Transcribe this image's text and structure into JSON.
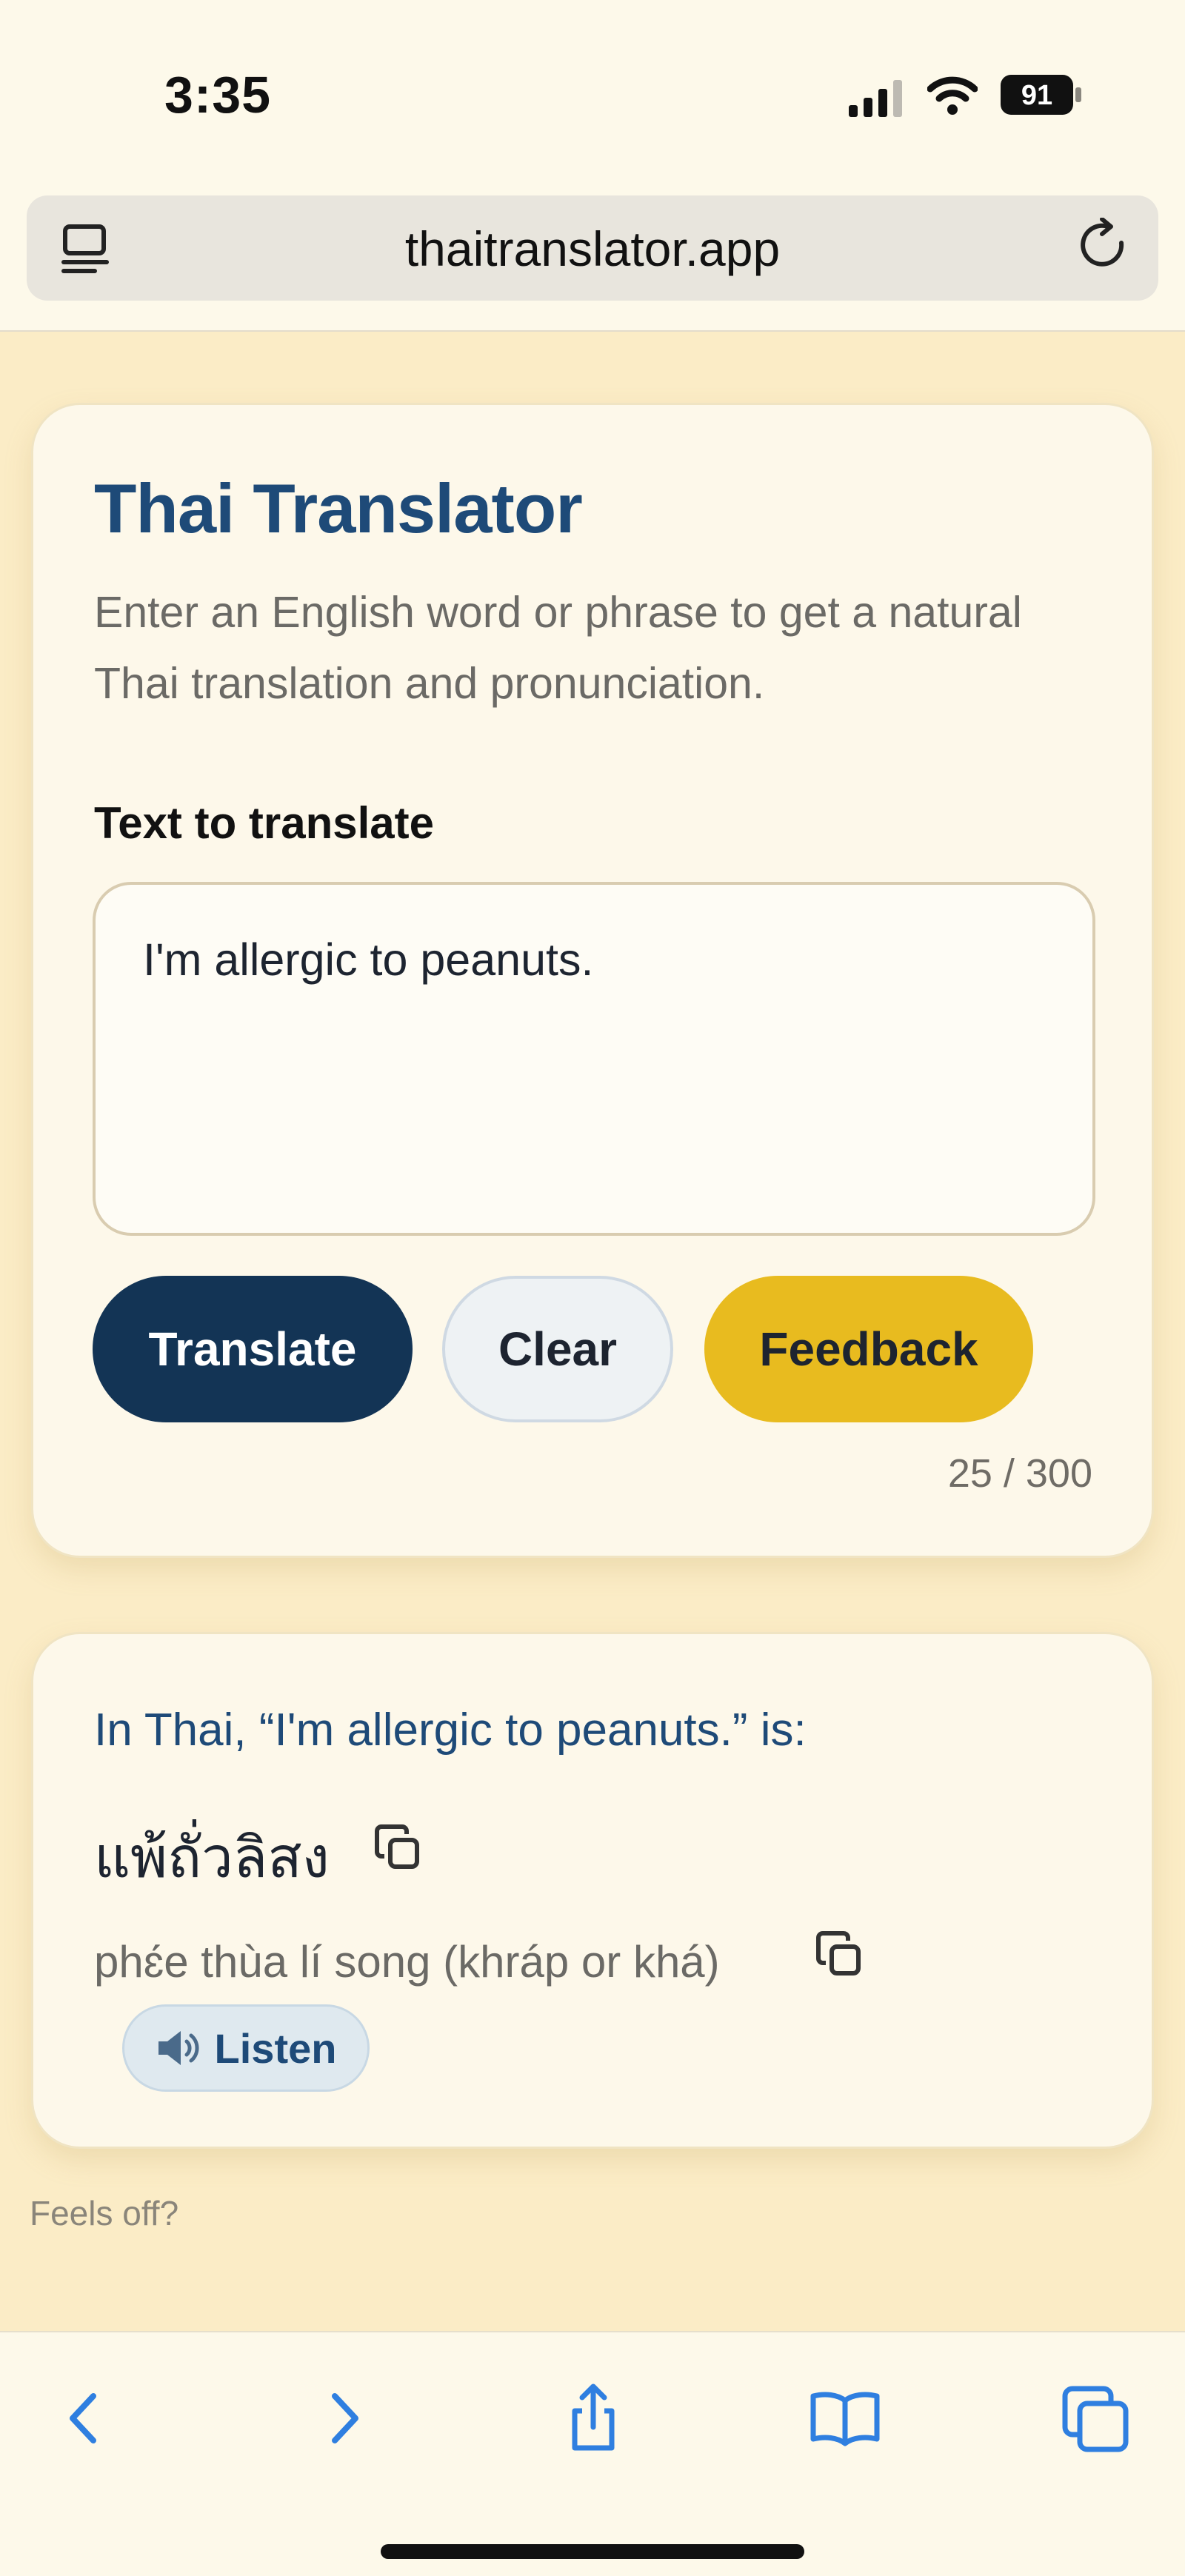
{
  "status": {
    "time": "3:35",
    "battery": "91"
  },
  "browser": {
    "url": "thaitranslator.app"
  },
  "translator": {
    "title": "Thai Translator",
    "subtitle": "Enter an English word or phrase to get a natural Thai translation and pronunciation.",
    "field_label": "Text to translate",
    "input_value": "I'm allergic to peanuts.",
    "buttons": {
      "translate": "Translate",
      "clear": "Clear",
      "feedback": "Feedback"
    },
    "char_count": "25 / 300"
  },
  "result": {
    "heading": "In Thai, “I'm allergic to peanuts.” is:",
    "thai": "แพ้ถั่วลิสง",
    "romanization": "phɛ́e thùa lí song (khráp or khá)",
    "listen_label": "Listen"
  },
  "footer": {
    "feels_off": "Feels off?"
  },
  "colors": {
    "accent": "#1e4a78",
    "primary_button": "#133455",
    "feedback_button": "#e8bb1f",
    "page_background": "#fbecc6",
    "system_blue": "#2f7fe0"
  }
}
